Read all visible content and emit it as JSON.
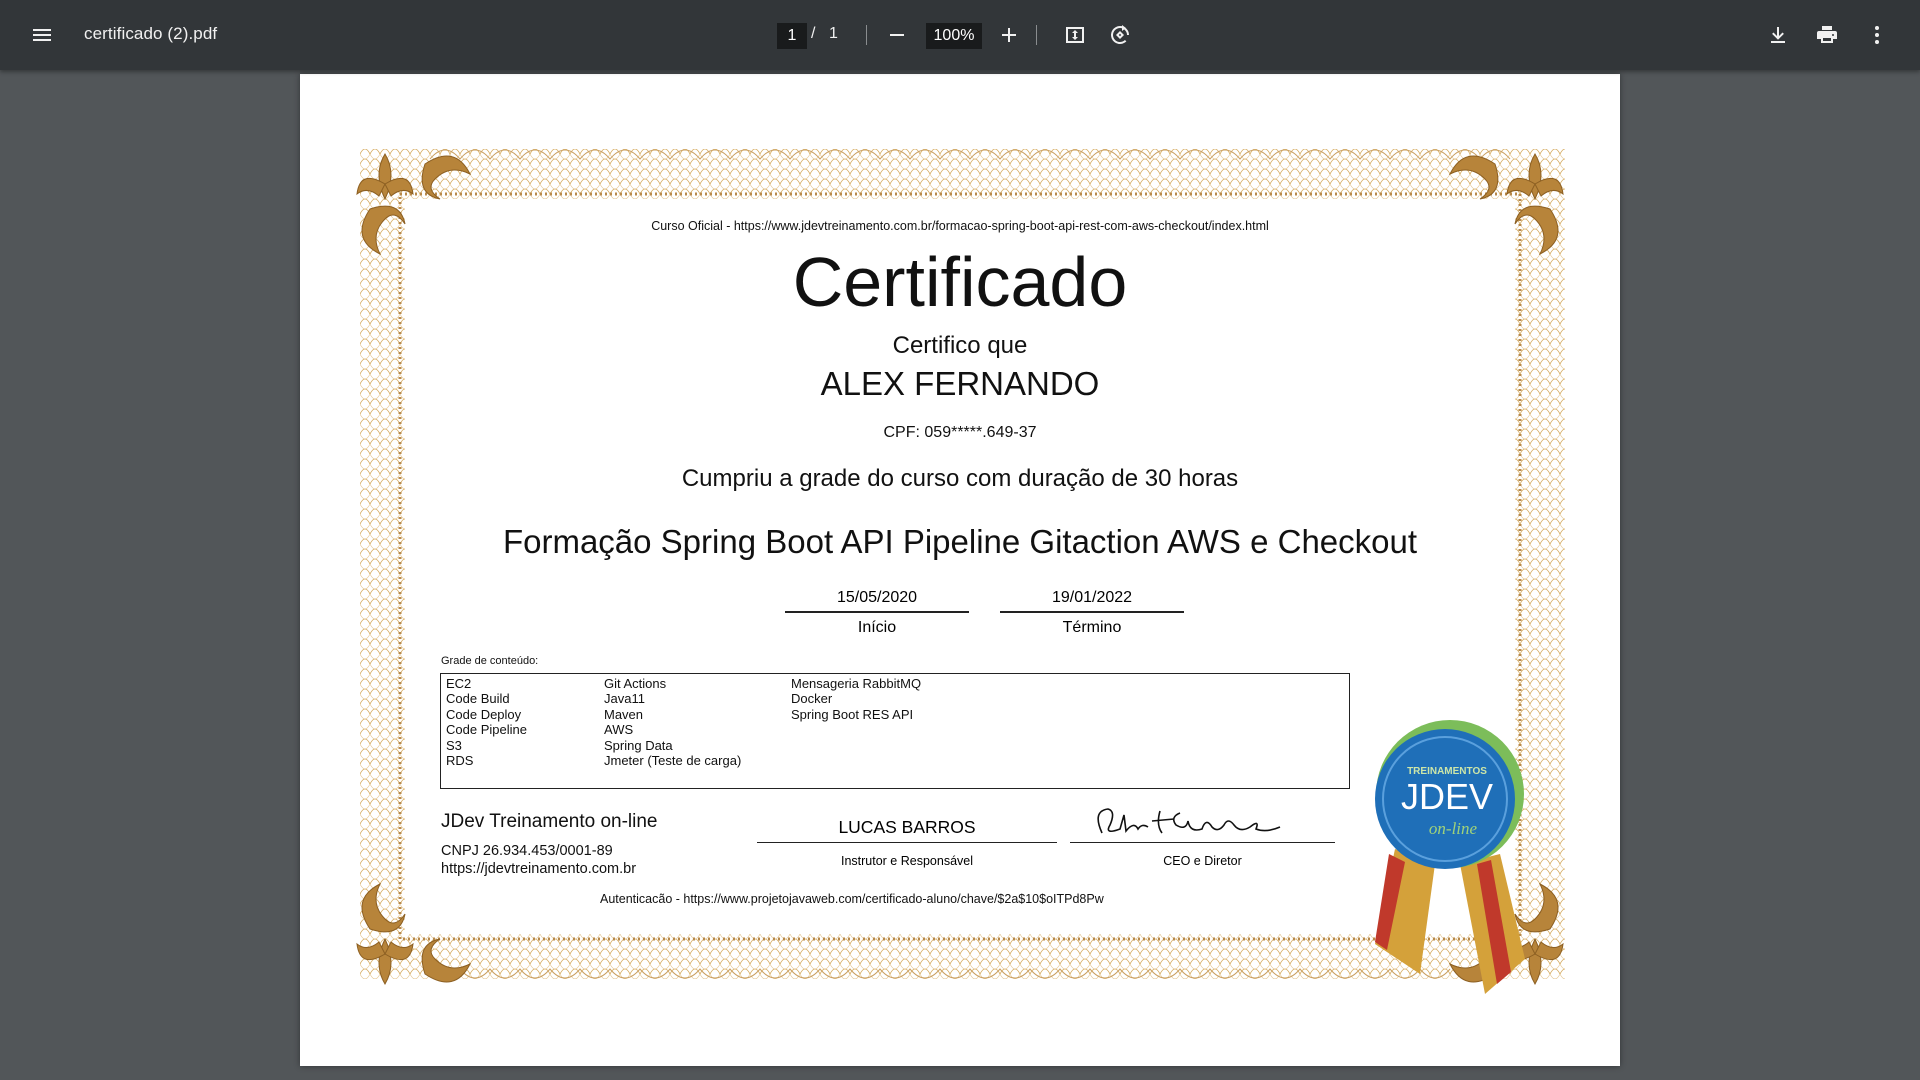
{
  "toolbar": {
    "file_name": "certificado (2).pdf",
    "current_page": "1",
    "page_separator": "/",
    "total_pages": "1",
    "zoom": "100%",
    "icons": [
      "menu-icon",
      "zoom-out-icon",
      "zoom-in-icon",
      "fit-page-icon",
      "rotate-icon",
      "download-icon",
      "print-icon",
      "more-vert-icon"
    ]
  },
  "certificate": {
    "source_url": "Curso Oficial - https://www.jdevtreinamento.com.br/formacao-spring-boot-api-rest-com-aws-checkout/index.html",
    "title": "Certificado",
    "certifico": "Certifico que",
    "student_name": "ALEX FERNANDO",
    "cpf": "CPF:  059*****.649-37",
    "completion": "Cumpriu a grade do curso com duração de 30 horas",
    "course_name": "Formação Spring Boot API Pipeline Gitaction AWS e Checkout",
    "start_date": "15/05/2020",
    "start_label": "Início",
    "end_date": "19/01/2022",
    "end_label": "Término",
    "grade_label": "Grade de conteúdo:",
    "grade_columns": [
      [
        "EC2",
        "Code Build",
        "Code Deploy",
        "Code Pipeline",
        "S3",
        "RDS"
      ],
      [
        "Git Actions",
        "Java11",
        "Maven",
        "AWS",
        "Spring Data",
        "Jmeter (Teste de carga)"
      ],
      [
        "Mensageria RabbitMQ",
        "Docker",
        "Spring Boot RES API"
      ]
    ],
    "org_name": "JDev Treinamento on-line",
    "cnpj": "CNPJ 26.934.453/0001-89",
    "org_url": "https://jdevtreinamento.com.br",
    "instructor_name": "LUCAS BARROS",
    "instructor_role": "Instrutor e Responsável",
    "ceo_signature": "Alex F. Egidio",
    "ceo_role": "CEO e Diretor",
    "authentication": "Autenticacão - https://www.projetojavaweb.com/certificado-aluno/chave/$2a$10$oITPd8Pw",
    "badge": {
      "line1": "TREINAMENTOS",
      "line2": "JDEV",
      "line3": "on-line"
    }
  },
  "colors": {
    "toolbar_bg": "#323639",
    "viewer_bg": "#525659",
    "border_gold": "#c9963e",
    "badge_blue": "#1f6fb8",
    "badge_green": "#7cbd5a",
    "ribbon_red": "#c0392b",
    "ribbon_gold": "#d4a13a"
  }
}
